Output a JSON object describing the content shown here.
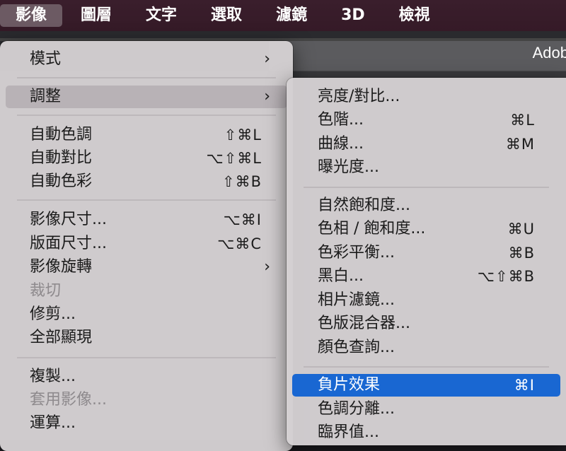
{
  "menubar": {
    "items": [
      "影像",
      "圖層",
      "文字",
      "選取",
      "濾鏡",
      "3D",
      "檢視"
    ]
  },
  "app": {
    "title": "Adob"
  },
  "image_menu": {
    "items": [
      {
        "label": "模式",
        "submenu": true
      },
      {
        "label": "調整",
        "submenu": true
      },
      {
        "label": "自動色調",
        "shortcut": "⇧⌘L"
      },
      {
        "label": "自動對比",
        "shortcut": "⌥⇧⌘L"
      },
      {
        "label": "自動色彩",
        "shortcut": "⇧⌘B"
      },
      {
        "label": "影像尺寸...",
        "shortcut": "⌥⌘I"
      },
      {
        "label": "版面尺寸...",
        "shortcut": "⌥⌘C"
      },
      {
        "label": "影像旋轉",
        "submenu": true
      },
      {
        "label": "裁切",
        "disabled": true
      },
      {
        "label": "修剪..."
      },
      {
        "label": "全部顯現"
      },
      {
        "label": "複製..."
      },
      {
        "label": "套用影像...",
        "disabled": true
      },
      {
        "label": "運算..."
      }
    ],
    "submenu_arrow": "›"
  },
  "adjust_menu": {
    "items": [
      {
        "label": "亮度/對比..."
      },
      {
        "label": "色階...",
        "shortcut": "⌘L"
      },
      {
        "label": "曲線...",
        "shortcut": "⌘M"
      },
      {
        "label": "曝光度..."
      },
      {
        "label": "自然飽和度..."
      },
      {
        "label": "色相 / 飽和度...",
        "shortcut": "⌘U"
      },
      {
        "label": "色彩平衡...",
        "shortcut": "⌘B"
      },
      {
        "label": "黑白...",
        "shortcut": "⌥⇧⌘B"
      },
      {
        "label": "相片濾鏡..."
      },
      {
        "label": "色版混合器..."
      },
      {
        "label": "顏色查詢..."
      },
      {
        "label": "負片效果",
        "shortcut": "⌘I",
        "selected": true
      },
      {
        "label": "色調分離..."
      },
      {
        "label": "臨界值..."
      }
    ]
  },
  "colors": {
    "menubar_bg": "#371b29",
    "menu_bg": "#d4cfd2",
    "selected_bg": "#1967d2",
    "hover_bg": "#b8b2b6"
  }
}
